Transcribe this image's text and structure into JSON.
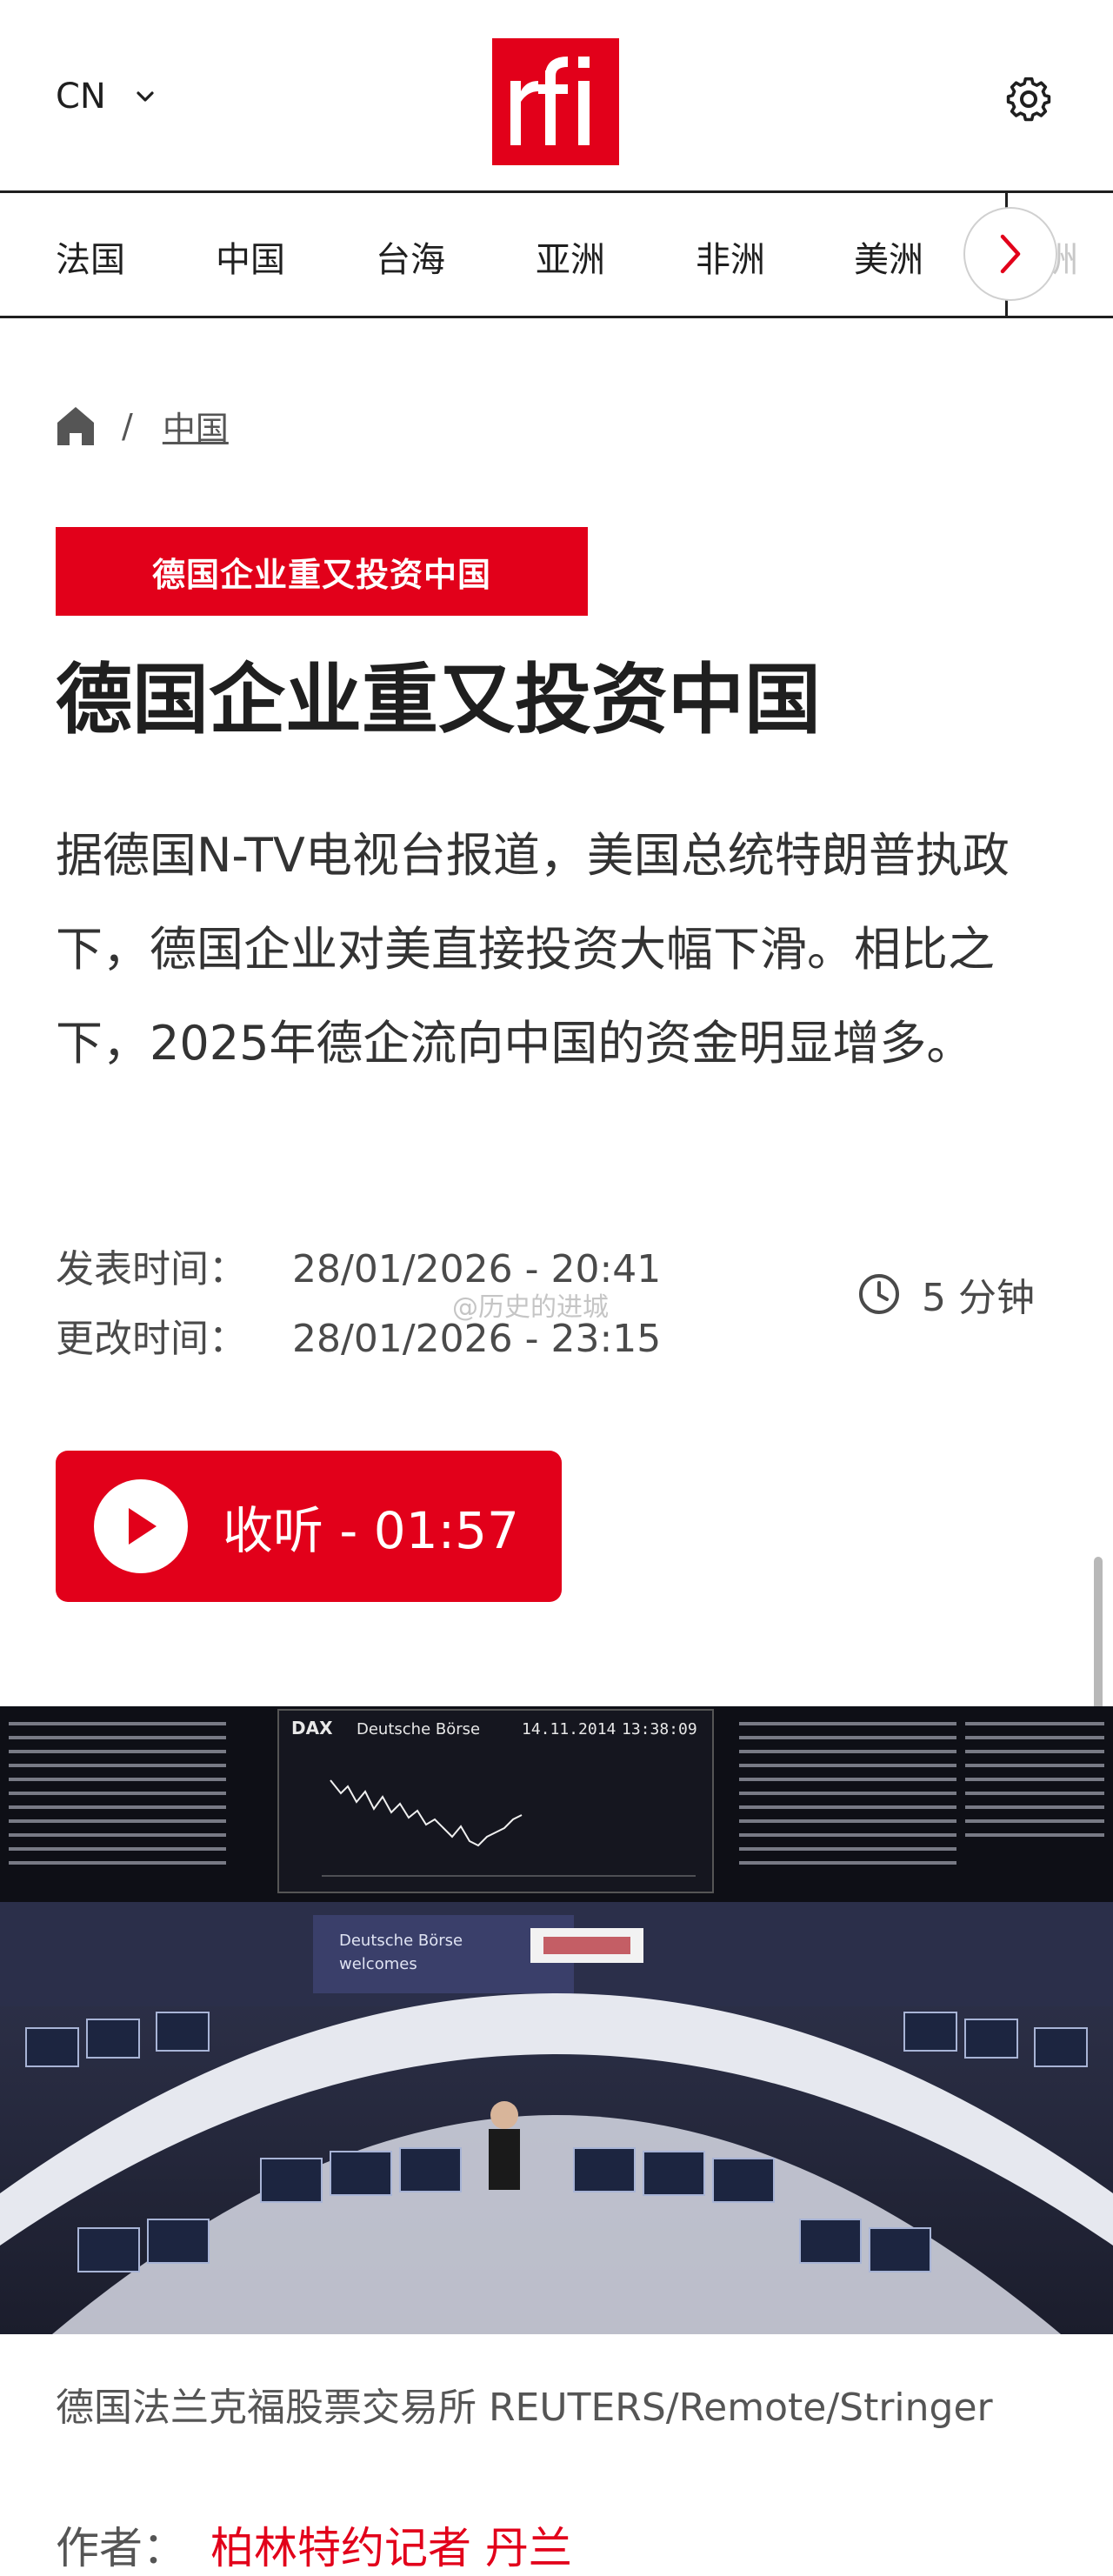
{
  "header": {
    "lang": "CN",
    "logo_text": "rfi"
  },
  "nav": {
    "items": [
      "法国",
      "中国",
      "台海",
      "亚洲",
      "非洲",
      "美洲"
    ],
    "partial_item": "洲"
  },
  "breadcrumb": {
    "separator": "/",
    "current": "中国"
  },
  "article": {
    "tag": "德国企业重又投资中国",
    "title": "德国企业重又投资中国",
    "summary": "据德国N-TV电视台报道，美国总统特朗普执政下，德国企业对美直接投资大幅下滑。相比之下，2025年德企流向中国的资金明显增多。",
    "published_label": "发表时间：",
    "published_value": "28/01/2026 - 20:41",
    "updated_label": "更改时间：",
    "updated_value": "28/01/2026 - 23:15",
    "read_time": "5 分钟",
    "listen_label": "收听 - 01:57",
    "photo_caption": "德国法兰克福股票交易所 REUTERS/Remote/Stringer",
    "author_label": "作者：",
    "author_name": "柏林特约记者 丹兰"
  },
  "photo": {
    "board_title": "Deutsche Börse",
    "board_index": "DAX",
    "board_date": "14.11.2014",
    "board_time": "13:38:09",
    "welcome_line1": "Deutsche Börse",
    "welcome_line2": "welcomes"
  },
  "watermark": "@历史的进城",
  "colors": {
    "brand_red": "#e2001a",
    "text_dark": "#1f1f1f",
    "text_muted": "#555555"
  }
}
